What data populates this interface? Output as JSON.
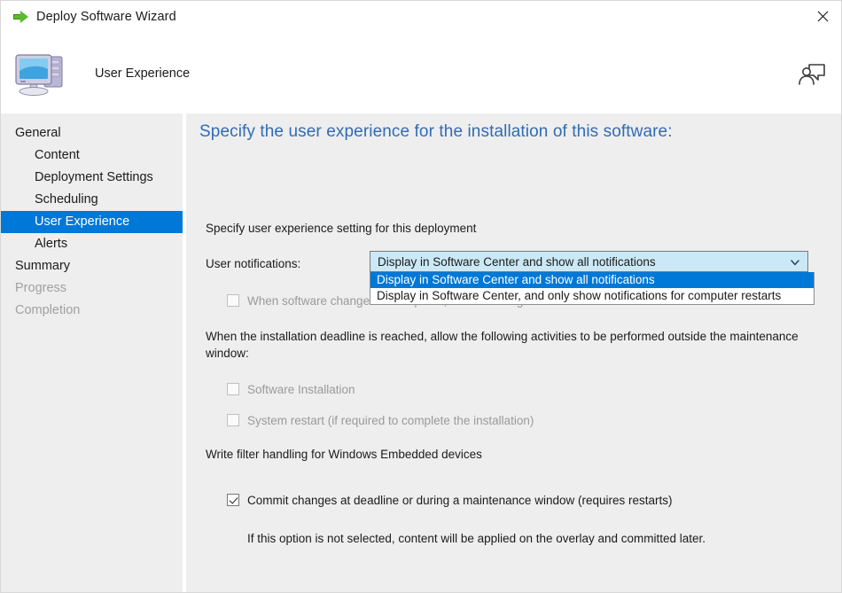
{
  "window": {
    "title": "Deploy Software Wizard",
    "title_icon": "green-arrow-icon",
    "close_label": "✕"
  },
  "header": {
    "title": "User Experience",
    "icon": "computer-icon",
    "feedback_icon": "feedback-person-icon"
  },
  "sidebar": {
    "items": [
      {
        "label": "General",
        "level": 0,
        "state": "normal"
      },
      {
        "label": "Content",
        "level": 1,
        "state": "normal"
      },
      {
        "label": "Deployment Settings",
        "level": 1,
        "state": "normal"
      },
      {
        "label": "Scheduling",
        "level": 1,
        "state": "normal"
      },
      {
        "label": "User Experience",
        "level": 1,
        "state": "selected"
      },
      {
        "label": "Alerts",
        "level": 1,
        "state": "normal"
      },
      {
        "label": "Summary",
        "level": 0,
        "state": "normal"
      },
      {
        "label": "Progress",
        "level": 0,
        "state": "disabled"
      },
      {
        "label": "Completion",
        "level": 0,
        "state": "disabled"
      }
    ]
  },
  "main": {
    "heading": "Specify the user experience for the installation of this software:",
    "section_label": "Specify user experience setting for this deployment",
    "user_notifications_label": "User notifications:",
    "notifications_combo": {
      "value": "Display in Software Center and show all notifications",
      "expanded": true,
      "options": [
        "Display in Software Center and show all notifications",
        "Display in Software Center, and only show notifications for computer restarts"
      ],
      "highlighted_index": 0
    },
    "dialog_checkbox": {
      "label": "When software changes are required, show a dialog window to the user instead of a toast notification.",
      "checked": false,
      "enabled": false
    },
    "deadline_text": "When the installation deadline is reached, allow the following activities to be performed outside the maintenance window:",
    "deadline_checkboxes": [
      {
        "label": "Software Installation",
        "checked": false,
        "enabled": false
      },
      {
        "label": "System restart  (if required to complete the installation)",
        "checked": false,
        "enabled": false
      }
    ],
    "write_filter_label": "Write filter handling for Windows Embedded devices",
    "commit_checkbox": {
      "label": "Commit changes at deadline or during a maintenance window (requires restarts)",
      "checked": true,
      "enabled": true
    },
    "commit_note": "If this option is not selected, content will be applied on the overlay and committed later."
  },
  "colors": {
    "accent": "#0078d7",
    "heading": "#2f6cb5",
    "body_bg": "#eeeeee",
    "combo_bg": "#cbe8f6"
  }
}
